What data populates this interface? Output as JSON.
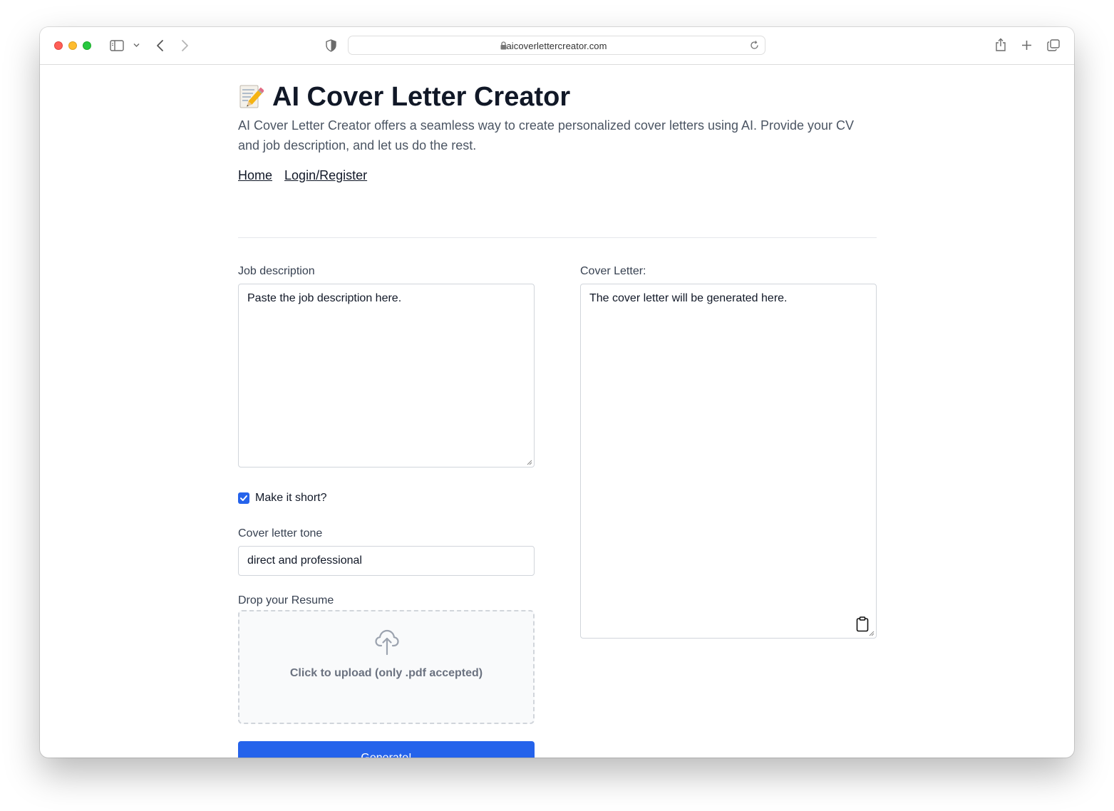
{
  "browser": {
    "url": "aicoverlettercreator.com"
  },
  "header": {
    "emoji": "📝",
    "title": "AI Cover Letter Creator",
    "subtitle": "AI Cover Letter Creator offers a seamless way to create personalized cover letters using AI. Provide your CV and job description, and let us do the rest.",
    "nav": [
      "Home",
      "Login/Register"
    ]
  },
  "form": {
    "job_label": "Job description",
    "job_placeholder": "Paste the job description here.",
    "short_label": "Make it short?",
    "short_checked": true,
    "tone_label": "Cover letter tone",
    "tone_value": "direct and professional",
    "resume_label": "Drop your Resume",
    "upload_text": "Click to upload (only .pdf accepted)",
    "generate_label": "Generate!"
  },
  "output": {
    "label": "Cover Letter:",
    "placeholder": "The cover letter will be generated here."
  },
  "colors": {
    "accent": "#2563eb",
    "heading": "#111827",
    "muted": "#4b5563"
  }
}
